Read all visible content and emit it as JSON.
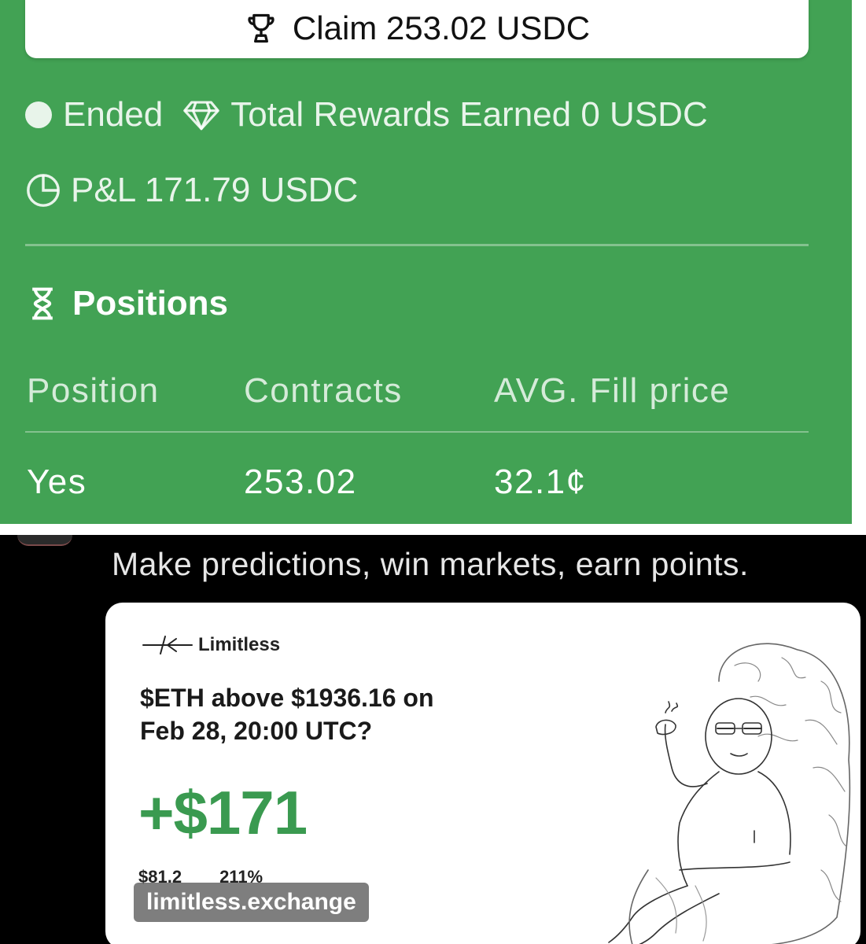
{
  "claim": {
    "label": "Claim 253.02 USDC"
  },
  "status": {
    "state": "Ended",
    "rewards": "Total Rewards Earned 0 USDC",
    "pnl": "P&L 171.79 USDC"
  },
  "positions": {
    "heading": "Positions",
    "columns": [
      "Position",
      "Contracts",
      "AVG. Fill price"
    ],
    "rows": [
      {
        "position": "Yes",
        "contracts": "253.02",
        "avg_fill_price": "32.1¢"
      }
    ]
  },
  "promo": {
    "headline": "Make predictions, win markets, earn points.",
    "brand": "Limitless",
    "question_line1": "$ETH above $1936.16 on",
    "question_line2": "Feb 28, 20:00 UTC?",
    "pnl": "+$171",
    "cost": "$81.2",
    "return": "211%",
    "url": "limitless.exchange"
  },
  "colors": {
    "panel_green": "#42a254",
    "pnl_green": "#3a9a50"
  }
}
